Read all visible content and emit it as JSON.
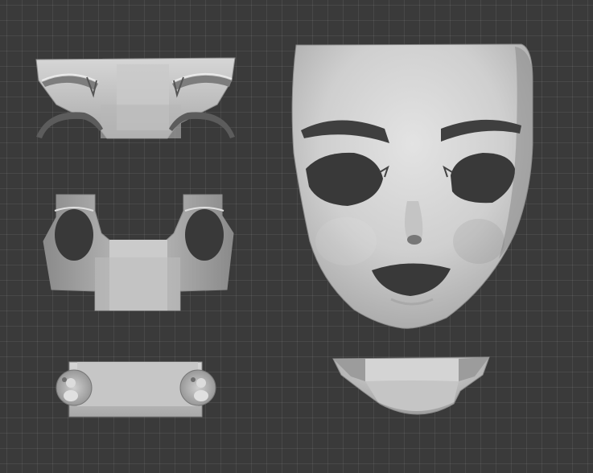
{
  "viewport": {
    "grid_color": "#4a4a4a",
    "background_color": "#3a3a3a",
    "mesh_color": "#bdbdbd",
    "mesh_shadow": "#7f7f7f",
    "mesh_highlight": "#e6e6e6",
    "line_color": "#2f2f2f"
  },
  "scene": {
    "objects": [
      {
        "name": "brow-mask-piece",
        "icon": "mesh-icon"
      },
      {
        "name": "eye-socket-piece",
        "icon": "mesh-icon"
      },
      {
        "name": "eyeball-strip-piece",
        "icon": "mesh-icon"
      },
      {
        "name": "face-mask",
        "icon": "mesh-icon"
      },
      {
        "name": "mouth-jaw-piece",
        "icon": "mesh-icon"
      }
    ]
  }
}
